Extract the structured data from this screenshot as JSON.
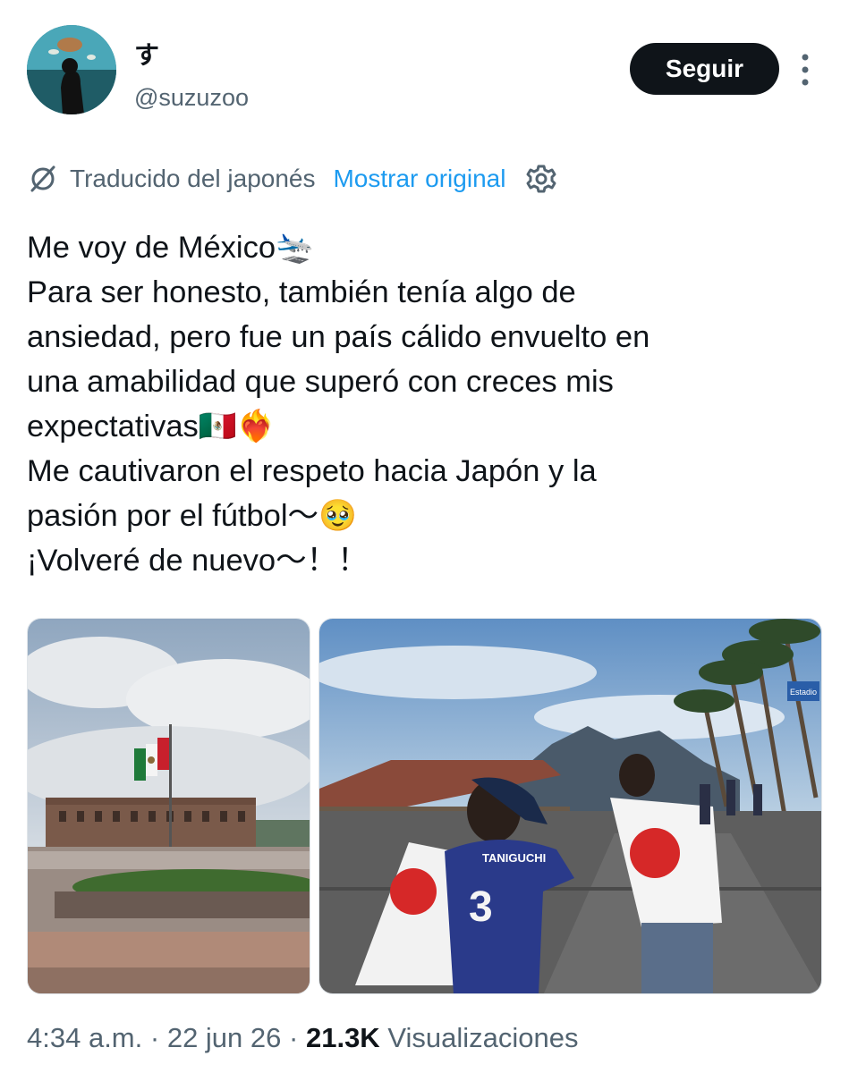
{
  "author": {
    "display_name": "す",
    "handle": "@suzuzoo",
    "avatar_icon": "profile-photo-aquarium"
  },
  "actions": {
    "follow_label": "Seguir",
    "more_icon": "more-vertical-icon"
  },
  "translation": {
    "label": "Traducido del japonés",
    "show_original": "Mostrar original",
    "icon": "translate-icon",
    "settings_icon": "gear-icon"
  },
  "tweet": {
    "lines": [
      "Me voy de México🛬",
      "Para ser honesto, también tenía algo de",
      "ansiedad, pero fue un país cálido envuelto en",
      "una amabilidad que superó con creces mis",
      "expectativas🇲🇽❤️‍🔥",
      "Me cautivaron el respeto hacia Japón y la",
      "pasión por el fútbol〜🥹",
      "¡Volveré de nuevo〜！！"
    ]
  },
  "media": [
    {
      "name": "photo-government-palace",
      "content": "Mexican flag in front of government palace plaza"
    },
    {
      "name": "photo-fans-japan-flags",
      "content": "Japan fans walking with flags",
      "sign_text": "Estadio",
      "jersey_name": "TANIGUCHI",
      "jersey_number": "3"
    }
  ],
  "meta": {
    "time": "4:34 a.m.",
    "separator": "·",
    "date": "22 jun 26",
    "views_count": "21.3K",
    "views_label": "Visualizaciones"
  },
  "colors": {
    "text": "#0f1419",
    "secondary": "#536471",
    "link": "#1d9bf0",
    "button_bg": "#0f1419",
    "button_text": "#ffffff"
  }
}
